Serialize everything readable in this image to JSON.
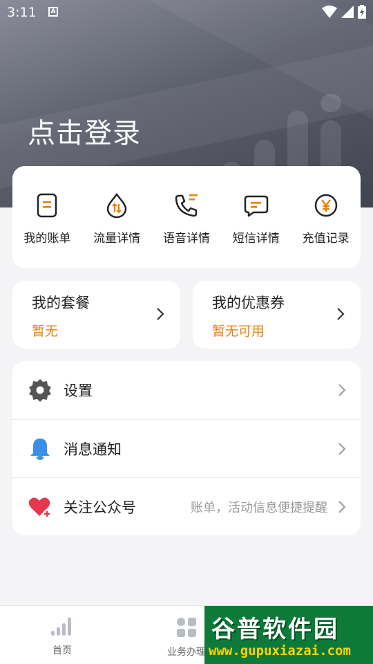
{
  "status_bar": {
    "time": "3:11",
    "notif_letter": "A"
  },
  "header": {
    "login_text": "点击登录"
  },
  "quick_actions": [
    {
      "label": "我的账单",
      "icon": "bill-icon"
    },
    {
      "label": "流量详情",
      "icon": "data-drop-icon"
    },
    {
      "label": "语音详情",
      "icon": "phone-icon"
    },
    {
      "label": "短信详情",
      "icon": "message-icon"
    },
    {
      "label": "充值记录",
      "icon": "yen-icon"
    }
  ],
  "package": {
    "title": "我的套餐",
    "value": "暂无"
  },
  "coupon": {
    "title": "我的优惠券",
    "value": "暂无可用"
  },
  "settings_list": [
    {
      "label": "设置",
      "hint": "",
      "icon": "gear-icon"
    },
    {
      "label": "消息通知",
      "hint": "",
      "icon": "bell-icon"
    },
    {
      "label": "关注公众号",
      "hint": "账单，活动信息便捷提醒",
      "icon": "heart-plus-icon"
    }
  ],
  "bottom_nav": [
    {
      "label": "首页",
      "icon": "signal-bars-icon"
    },
    {
      "label": "业务办理",
      "icon": "grid-icon"
    }
  ],
  "watermark": {
    "title": "谷普软件园",
    "url": "www.gupuxiazai.com"
  },
  "colors": {
    "accent": "#e8820c",
    "bell": "#3a8fe8",
    "heart": "#e8364f",
    "gear": "#555555"
  }
}
